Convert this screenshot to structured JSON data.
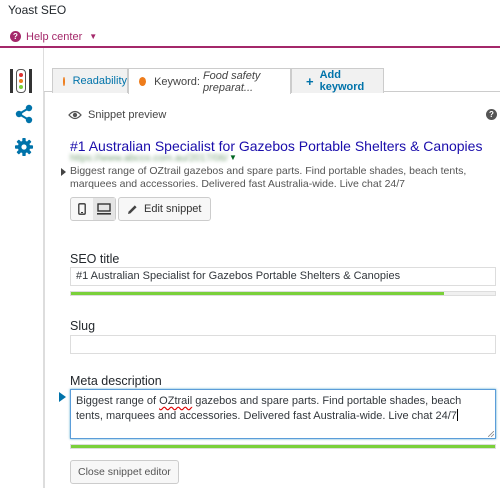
{
  "app": {
    "title": "Yoast SEO"
  },
  "help": {
    "label": "Help center",
    "icon": "question-icon"
  },
  "nav": {
    "items": [
      {
        "name": "traffic-light-icon"
      },
      {
        "name": "share-icon"
      },
      {
        "name": "gear-icon"
      }
    ]
  },
  "tabs": [
    {
      "label": "Readability",
      "status_color": "#ee7c1b"
    },
    {
      "label": "Keyword:",
      "keyword": "Food safety preparat...",
      "status_color": "#ee7c1b"
    },
    {
      "label": "Add keyword",
      "icon": "plus-icon"
    }
  ],
  "snippet": {
    "header": "Snippet preview",
    "title": "#1 Australian Specialist for Gazebos Portable Shelters & Canopies",
    "url": "https://www.abcco.com.au/2017/06/",
    "description": "Biggest range of OZtrail gazebos and spare parts. Find portable shades, beach tents, marquees and accessories. Delivered fast Australia-wide. Live chat 24/7",
    "edit_label": "Edit snippet",
    "mode": "desktop"
  },
  "editor": {
    "seo_title_label": "SEO title",
    "seo_title_value": "#1 Australian Specialist for Gazebos Portable Shelters & Canopies",
    "seo_title_progress": 0.88,
    "slug_label": "Slug",
    "slug_value": "",
    "meta_label": "Meta description",
    "meta_before": "Biggest range of ",
    "meta_misspelled": "OZtrail",
    "meta_after": " gazebos and spare parts. Find portable shades, beach tents, marquees and accessories. Delivered fast Australia-wide. Live chat 24/7",
    "meta_progress": 1.0,
    "close_label": "Close snippet editor"
  },
  "colors": {
    "brand": "#a4286a",
    "link": "#1a0dab",
    "progress_good": "#7ad03a",
    "status_ok": "#ee7c1b",
    "accent_blue": "#0073aa"
  }
}
